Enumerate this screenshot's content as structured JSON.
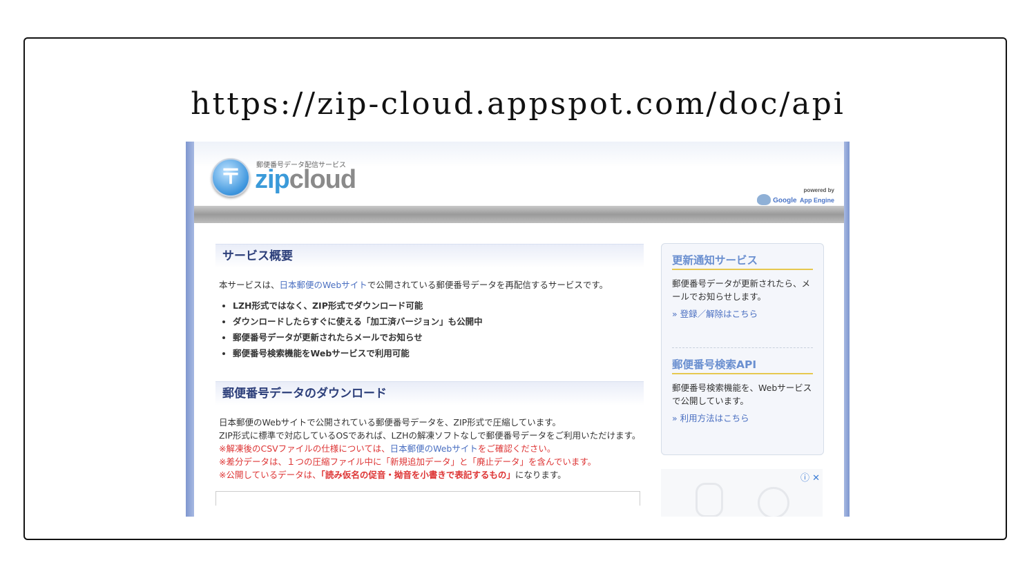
{
  "slide": {
    "heading": "https://zip-cloud.appspot.com/doc/api"
  },
  "site": {
    "logo_glyph": "〒",
    "logo_subtitle": "郵便番号データ配信サービス",
    "logo_zip": "zip",
    "logo_cloud": "cloud",
    "powered_by": "powered by",
    "powered_google": "Google",
    "powered_engine": "App Engine"
  },
  "main": {
    "section1": {
      "title": "サービス概要",
      "intro_pre": "本サービスは、",
      "intro_link": "日本郵便のWebサイト",
      "intro_post": "で公開されている郵便番号データを再配信するサービスです。",
      "bullets": [
        "LZH形式ではなく、ZIP形式でダウンロード可能",
        "ダウンロードしたらすぐに使える「加工済バージョン」も公開中",
        "郵便番号データが更新されたらメールでお知らせ",
        "郵便番号検索機能をWebサービスで利用可能"
      ]
    },
    "section2": {
      "title": "郵便番号データのダウンロード",
      "line1": "日本郵便のWebサイトで公開されている郵便番号データを、ZIP形式で圧縮しています。",
      "line2": "ZIP形式に標準で対応しているOSであれば、LZHの解凍ソフトなしで郵便番号データをご利用いただけます。",
      "note1_pre": "※解凍後のCSVファイルの仕様については、",
      "note1_link": "日本郵便のWebサイト",
      "note1_post": "をご確認ください。",
      "note2": "※差分データは、１つの圧縮ファイル中に「新規追加データ」と「廃止データ」を含んでいます。",
      "note3_pre": "※公開しているデータは、",
      "note3_bold": "「読み仮名の促音・拗音を小書きで表記するもの」",
      "note3_post": "になります。"
    }
  },
  "sidebar": {
    "block1": {
      "title": "更新通知サービス",
      "text": "郵便番号データが更新されたら、メールでお知らせします。",
      "link": "» 登録／解除はこちら"
    },
    "block2": {
      "title": "郵便番号検索API",
      "text": "郵便番号検索機能を、Webサービスで公開しています。",
      "link": "» 利用方法はこちら"
    }
  },
  "ad": {
    "icons": "ⓘ ✕"
  },
  "colors": {
    "heading_blue": "#2d3f7a",
    "link_blue": "#4a6fc1",
    "notice_red": "#dd3333",
    "side_border": "#7f97cf"
  }
}
